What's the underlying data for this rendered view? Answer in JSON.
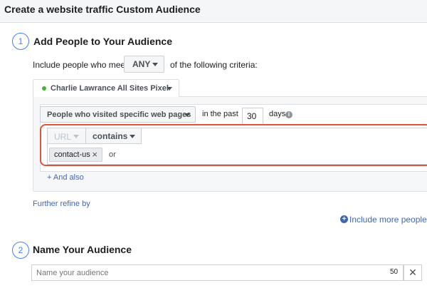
{
  "header": {
    "title": "Create a website traffic Custom Audience"
  },
  "step1": {
    "number": "1",
    "title": "Add People to Your Audience",
    "include_prefix": "Include people who meet",
    "match_type": "ANY",
    "include_suffix": "of the following criteria:",
    "pixel": {
      "name": "Charlie Lawrance All Sites Pixel",
      "status_color": "#42b72a"
    },
    "rule": {
      "visitor_type": "People who visited specific web pages",
      "in_the_past_label": "in the past",
      "days_value": "30",
      "days_label": "days",
      "info_icon_glyph": "i",
      "url_field": "URL",
      "operator": "contains",
      "tags": [
        {
          "label": "contact-us",
          "remove_glyph": "×"
        }
      ],
      "or_label": "or",
      "highlight_color": "#e0533f"
    },
    "and_also": "+ And also",
    "further_refine": "Further refine by",
    "include_more_people": "Include more people",
    "include_more_icon_glyph": "+"
  },
  "step2": {
    "number": "2",
    "title": "Name Your Audience",
    "name_placeholder": "Name your audience",
    "char_limit": "50",
    "clear_glyph": "✕"
  }
}
